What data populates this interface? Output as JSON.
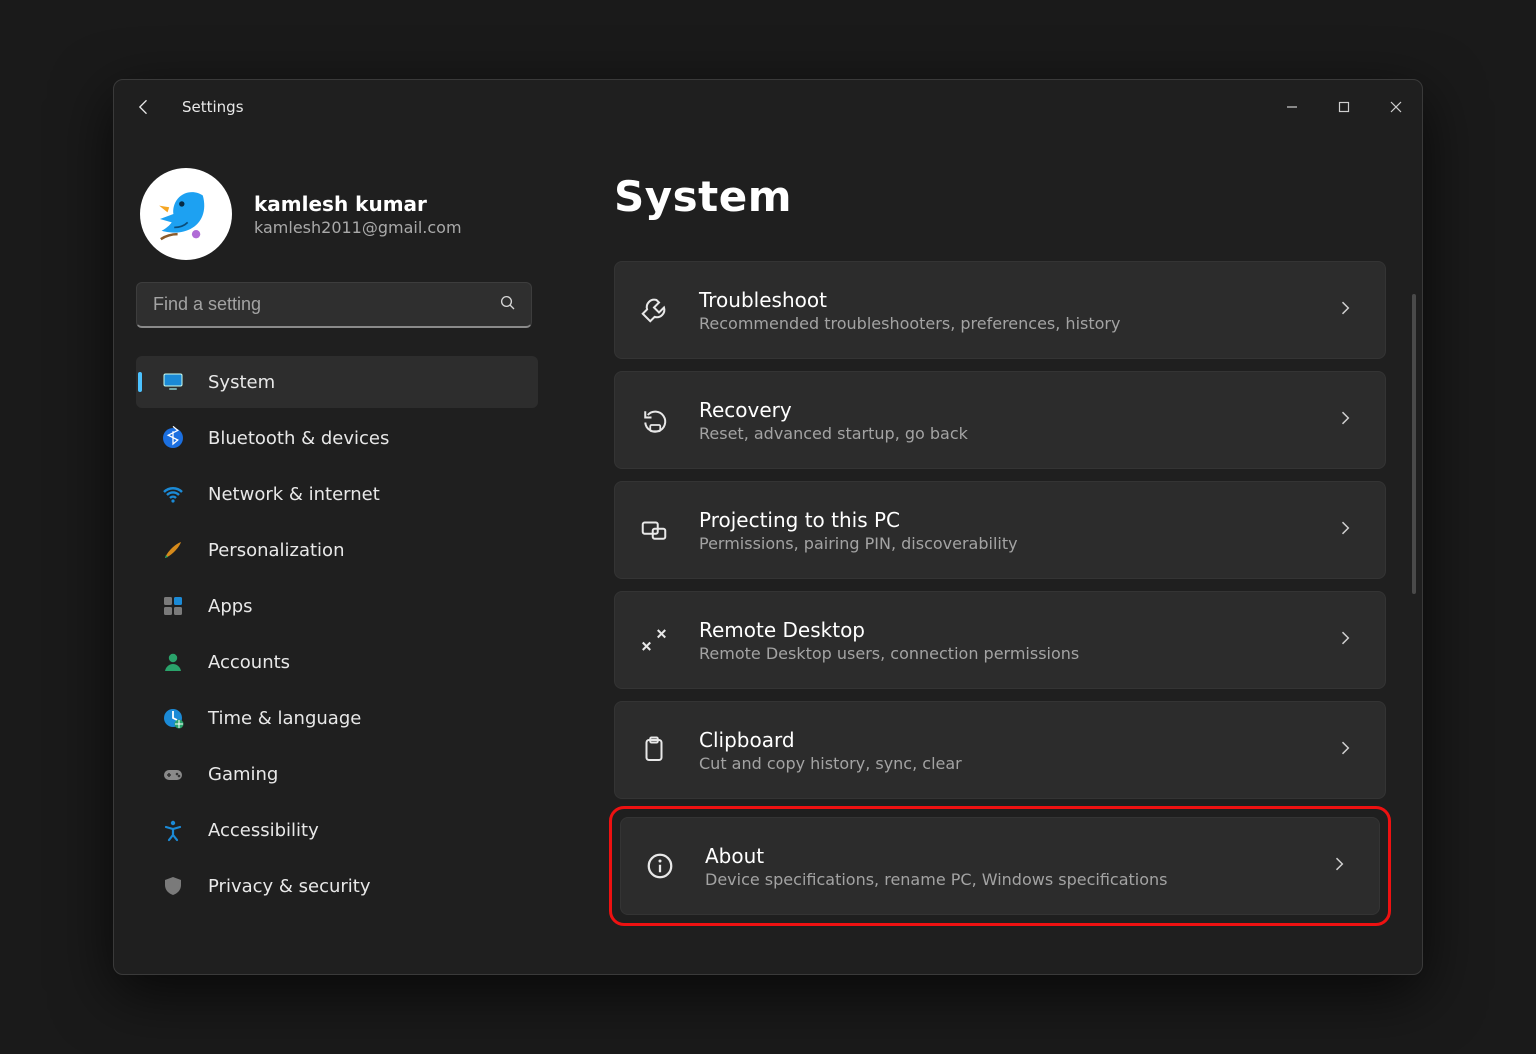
{
  "window": {
    "app_title": "Settings"
  },
  "profile": {
    "name": "kamlesh kumar",
    "email": "kamlesh2011@gmail.com"
  },
  "search": {
    "placeholder": "Find a setting",
    "value": ""
  },
  "sidebar": {
    "items": [
      {
        "id": "system",
        "label": "System",
        "icon": "monitor-icon",
        "active": true
      },
      {
        "id": "bluetooth",
        "label": "Bluetooth & devices",
        "icon": "bluetooth-icon",
        "active": false
      },
      {
        "id": "network",
        "label": "Network & internet",
        "icon": "wifi-icon",
        "active": false
      },
      {
        "id": "personalize",
        "label": "Personalization",
        "icon": "paintbrush-icon",
        "active": false
      },
      {
        "id": "apps",
        "label": "Apps",
        "icon": "apps-icon",
        "active": false
      },
      {
        "id": "accounts",
        "label": "Accounts",
        "icon": "person-icon",
        "active": false
      },
      {
        "id": "time-lang",
        "label": "Time & language",
        "icon": "clock-globe-icon",
        "active": false
      },
      {
        "id": "gaming",
        "label": "Gaming",
        "icon": "gamepad-icon",
        "active": false
      },
      {
        "id": "accessibility",
        "label": "Accessibility",
        "icon": "accessibility-icon",
        "active": false
      },
      {
        "id": "privacy",
        "label": "Privacy & security",
        "icon": "shield-icon",
        "active": false
      }
    ]
  },
  "main": {
    "title": "System",
    "cards": [
      {
        "id": "troubleshoot",
        "title": "Troubleshoot",
        "desc": "Recommended troubleshooters, preferences, history",
        "icon": "wrench-icon",
        "highlight": false
      },
      {
        "id": "recovery",
        "title": "Recovery",
        "desc": "Reset, advanced startup, go back",
        "icon": "recovery-icon",
        "highlight": false
      },
      {
        "id": "projecting",
        "title": "Projecting to this PC",
        "desc": "Permissions, pairing PIN, discoverability",
        "icon": "project-icon",
        "highlight": false
      },
      {
        "id": "remote",
        "title": "Remote Desktop",
        "desc": "Remote Desktop users, connection permissions",
        "icon": "remote-icon",
        "highlight": false
      },
      {
        "id": "clipboard",
        "title": "Clipboard",
        "desc": "Cut and copy history, sync, clear",
        "icon": "clipboard-icon",
        "highlight": false
      },
      {
        "id": "about",
        "title": "About",
        "desc": "Device specifications, rename PC, Windows specifications",
        "icon": "info-icon",
        "highlight": true
      }
    ]
  },
  "colors": {
    "accent": "#4cc2ff",
    "highlight_border": "#ee1111"
  }
}
